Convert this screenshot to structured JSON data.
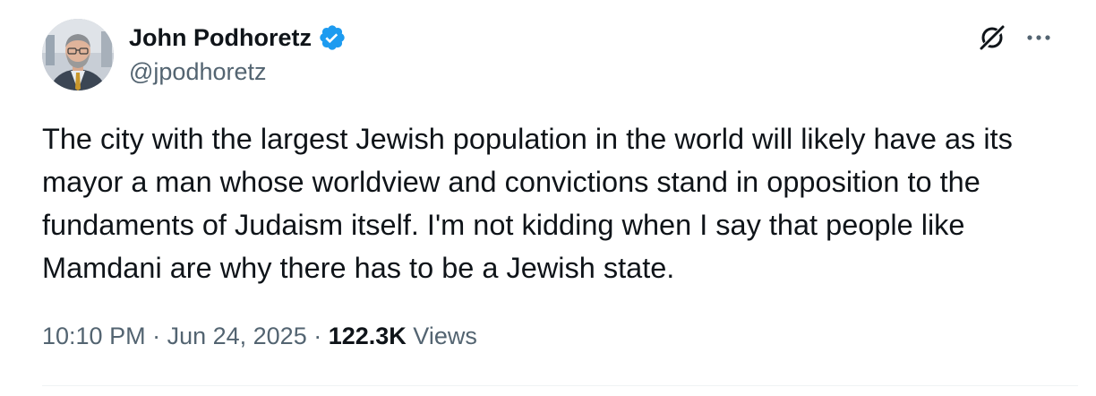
{
  "author": {
    "display_name": "John Podhoretz",
    "handle": "@jpodhoretz",
    "verified_icon": "verified-badge-icon",
    "avatar_icon": "profile-photo"
  },
  "actions": {
    "grok_icon": "grok-icon",
    "more_icon": "more-horizontal-icon"
  },
  "tweet": {
    "text": "The city with the largest Jewish population in the world will likely have as its mayor a man whose worldview and convictions stand in opposition to the fundaments of Judaism itself. I'm not kidding when I say that people like Mamdani are why there has to be a Jewish state."
  },
  "meta": {
    "time": "10:10 PM",
    "separator": " · ",
    "date": "Jun 24, 2025",
    "views_count": "122.3K",
    "views_label": " Views"
  },
  "colors": {
    "verified_blue": "#1d9bf0",
    "secondary_text": "#536471",
    "primary_text": "#0f1419"
  }
}
